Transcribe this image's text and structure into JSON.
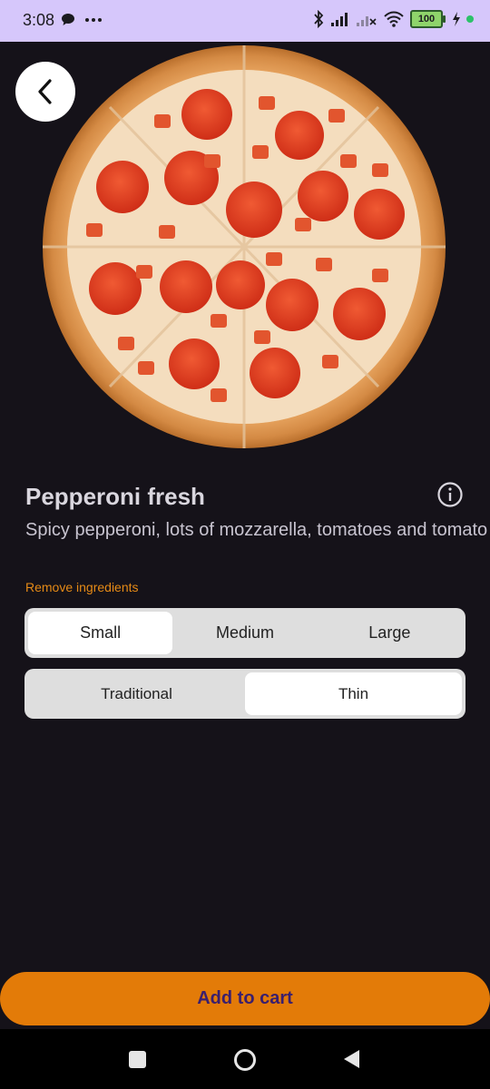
{
  "status_bar": {
    "time": "3:08",
    "battery_level": "100",
    "icons": [
      "chat-icon",
      "more-dots-icon",
      "bluetooth-icon",
      "signal-icon",
      "signal-no-service-icon",
      "wifi-icon",
      "battery-icon",
      "charging-icon"
    ]
  },
  "product": {
    "title": "Pepperoni fresh",
    "description": "Spicy pepperoni, lots of mozzarella, tomatoes and tomato sauce",
    "remove_ingredients_label": "Remove ingredients"
  },
  "size_selector": {
    "options": [
      "Small",
      "Medium",
      "Large"
    ],
    "selected": "Small"
  },
  "crust_selector": {
    "options": [
      "Traditional",
      "Thin"
    ],
    "selected": "Thin"
  },
  "actions": {
    "add_to_cart_label": "Add to cart"
  },
  "colors": {
    "background": "#151219",
    "accent": "#e37b08",
    "link": "#e58a16",
    "button_text": "#3a1f6e",
    "status_bar": "#d6c7fb"
  }
}
